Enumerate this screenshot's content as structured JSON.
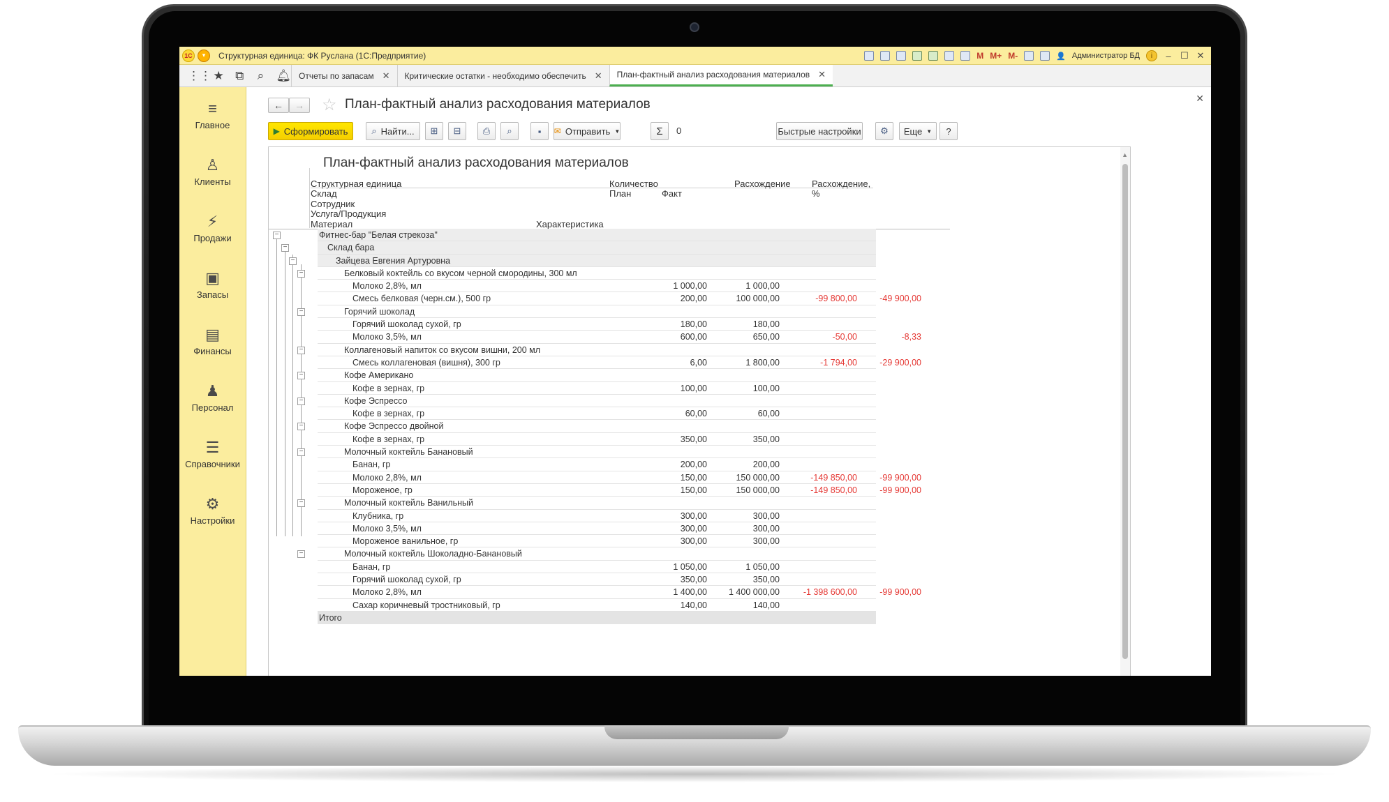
{
  "window": {
    "logo": "1С",
    "title": "Структурная единица: ФК Руслана  (1С:Предприятие)",
    "user": "Администратор БД",
    "m_buttons": [
      "M",
      "M+",
      "M-"
    ]
  },
  "tabs": [
    {
      "label": "Отчеты по запасам",
      "active": false
    },
    {
      "label": "Критические остатки - необходимо обеспечить",
      "active": false
    },
    {
      "label": "План-фактный анализ расходования материалов",
      "active": true
    }
  ],
  "sidebar": {
    "items": [
      {
        "label": "Главное",
        "icon": "menu-icon"
      },
      {
        "label": "Клиенты",
        "icon": "clients-icon"
      },
      {
        "label": "Продажи",
        "icon": "sales-icon"
      },
      {
        "label": "Запасы",
        "icon": "inventory-icon"
      },
      {
        "label": "Финансы",
        "icon": "wallet-icon"
      },
      {
        "label": "Персонал",
        "icon": "staff-icon"
      },
      {
        "label": "Справочники",
        "icon": "layers-icon"
      },
      {
        "label": "Настройки",
        "icon": "gear-icon"
      }
    ]
  },
  "form": {
    "title": "План-фактный анализ расходования материалов"
  },
  "toolbar": {
    "generate": "Сформировать",
    "find": "Найти...",
    "send": "Отправить",
    "sum_value": "0",
    "quick_settings": "Быстрые настройки",
    "more": "Еще",
    "help": "?"
  },
  "report": {
    "title": "План-фактный анализ расходования материалов",
    "headers": {
      "struct_unit": "Структурная единица",
      "warehouse": "Склад",
      "employee": "Сотрудник",
      "service": "Услуга/Продукция",
      "material": "Материал",
      "characteristic": "Характеристика",
      "quantity": "Количество",
      "plan": "План",
      "fact": "Факт",
      "diff": "Расхождение",
      "diff_pct": "Расхождение,",
      "pct_sign": "%"
    },
    "rows": [
      {
        "level": 0,
        "name": "Фитнес-бар \"Белая стрекоза\"",
        "plan": "",
        "fact": "",
        "diff": "",
        "pct": "",
        "group": true
      },
      {
        "level": 1,
        "name": "Склад бара",
        "plan": "",
        "fact": "",
        "diff": "",
        "pct": "",
        "group": true
      },
      {
        "level": 2,
        "name": "Зайцева Евгения Артуровна",
        "plan": "",
        "fact": "",
        "diff": "",
        "pct": "",
        "group": true
      },
      {
        "level": 3,
        "name": "Белковый коктейль со вкусом черной смородины, 300 мл",
        "plan": "",
        "fact": "",
        "diff": "",
        "pct": "",
        "group": false
      },
      {
        "level": 4,
        "name": "Молоко 2,8%, мл",
        "plan": "1 000,00",
        "fact": "1 000,00",
        "diff": "",
        "pct": ""
      },
      {
        "level": 4,
        "name": "Смесь белковая (черн.см.), 500 гр",
        "plan": "200,00",
        "fact": "100 000,00",
        "diff": "-99 800,00",
        "pct": "-49 900,00"
      },
      {
        "level": 3,
        "name": "Горячий шоколад",
        "plan": "",
        "fact": "",
        "diff": "",
        "pct": ""
      },
      {
        "level": 4,
        "name": "Горячий шоколад сухой, гр",
        "plan": "180,00",
        "fact": "180,00",
        "diff": "",
        "pct": ""
      },
      {
        "level": 4,
        "name": "Молоко 3,5%, мл",
        "plan": "600,00",
        "fact": "650,00",
        "diff": "-50,00",
        "pct": "-8,33"
      },
      {
        "level": 3,
        "name": "Коллагеновый напиток со вкусом вишни, 200 мл",
        "plan": "",
        "fact": "",
        "diff": "",
        "pct": ""
      },
      {
        "level": 4,
        "name": "Смесь коллагеновая (вишня), 300 гр",
        "plan": "6,00",
        "fact": "1 800,00",
        "diff": "-1 794,00",
        "pct": "-29 900,00"
      },
      {
        "level": 3,
        "name": "Кофе Американо",
        "plan": "",
        "fact": "",
        "diff": "",
        "pct": ""
      },
      {
        "level": 4,
        "name": "Кофе в зернах, гр",
        "plan": "100,00",
        "fact": "100,00",
        "diff": "",
        "pct": ""
      },
      {
        "level": 3,
        "name": "Кофе Эспрессо",
        "plan": "",
        "fact": "",
        "diff": "",
        "pct": ""
      },
      {
        "level": 4,
        "name": "Кофе в зернах, гр",
        "plan": "60,00",
        "fact": "60,00",
        "diff": "",
        "pct": ""
      },
      {
        "level": 3,
        "name": "Кофе Эспрессо двойной",
        "plan": "",
        "fact": "",
        "diff": "",
        "pct": ""
      },
      {
        "level": 4,
        "name": "Кофе в зернах, гр",
        "plan": "350,00",
        "fact": "350,00",
        "diff": "",
        "pct": ""
      },
      {
        "level": 3,
        "name": "Молочный коктейль Банановый",
        "plan": "",
        "fact": "",
        "diff": "",
        "pct": ""
      },
      {
        "level": 4,
        "name": "Банан, гр",
        "plan": "200,00",
        "fact": "200,00",
        "diff": "",
        "pct": ""
      },
      {
        "level": 4,
        "name": "Молоко 2,8%, мл",
        "plan": "150,00",
        "fact": "150 000,00",
        "diff": "-149 850,00",
        "pct": "-99 900,00"
      },
      {
        "level": 4,
        "name": "Мороженое, гр",
        "plan": "150,00",
        "fact": "150 000,00",
        "diff": "-149 850,00",
        "pct": "-99 900,00"
      },
      {
        "level": 3,
        "name": "Молочный коктейль Ванильный",
        "plan": "",
        "fact": "",
        "diff": "",
        "pct": ""
      },
      {
        "level": 4,
        "name": "Клубника, гр",
        "plan": "300,00",
        "fact": "300,00",
        "diff": "",
        "pct": ""
      },
      {
        "level": 4,
        "name": "Молоко 3,5%, мл",
        "plan": "300,00",
        "fact": "300,00",
        "diff": "",
        "pct": ""
      },
      {
        "level": 4,
        "name": "Мороженое ванильное, гр",
        "plan": "300,00",
        "fact": "300,00",
        "diff": "",
        "pct": ""
      },
      {
        "level": 3,
        "name": "Молочный коктейль Шоколадно-Банановый",
        "plan": "",
        "fact": "",
        "diff": "",
        "pct": ""
      },
      {
        "level": 4,
        "name": "Банан, гр",
        "plan": "1 050,00",
        "fact": "1 050,00",
        "diff": "",
        "pct": ""
      },
      {
        "level": 4,
        "name": "Горячий шоколад сухой, гр",
        "plan": "350,00",
        "fact": "350,00",
        "diff": "",
        "pct": ""
      },
      {
        "level": 4,
        "name": "Молоко 2,8%, мл",
        "plan": "1 400,00",
        "fact": "1 400 000,00",
        "diff": "-1 398 600,00",
        "pct": "-99 900,00"
      },
      {
        "level": 4,
        "name": "Сахар коричневый тростниковый, гр",
        "plan": "140,00",
        "fact": "140,00",
        "diff": "",
        "pct": ""
      }
    ],
    "total_label": "Итого"
  },
  "colors": {
    "sidebar_bg": "#fbed9e",
    "primary_button": "#ffe600",
    "negative": "#e53935",
    "active_tab_underline": "#4caf50"
  }
}
